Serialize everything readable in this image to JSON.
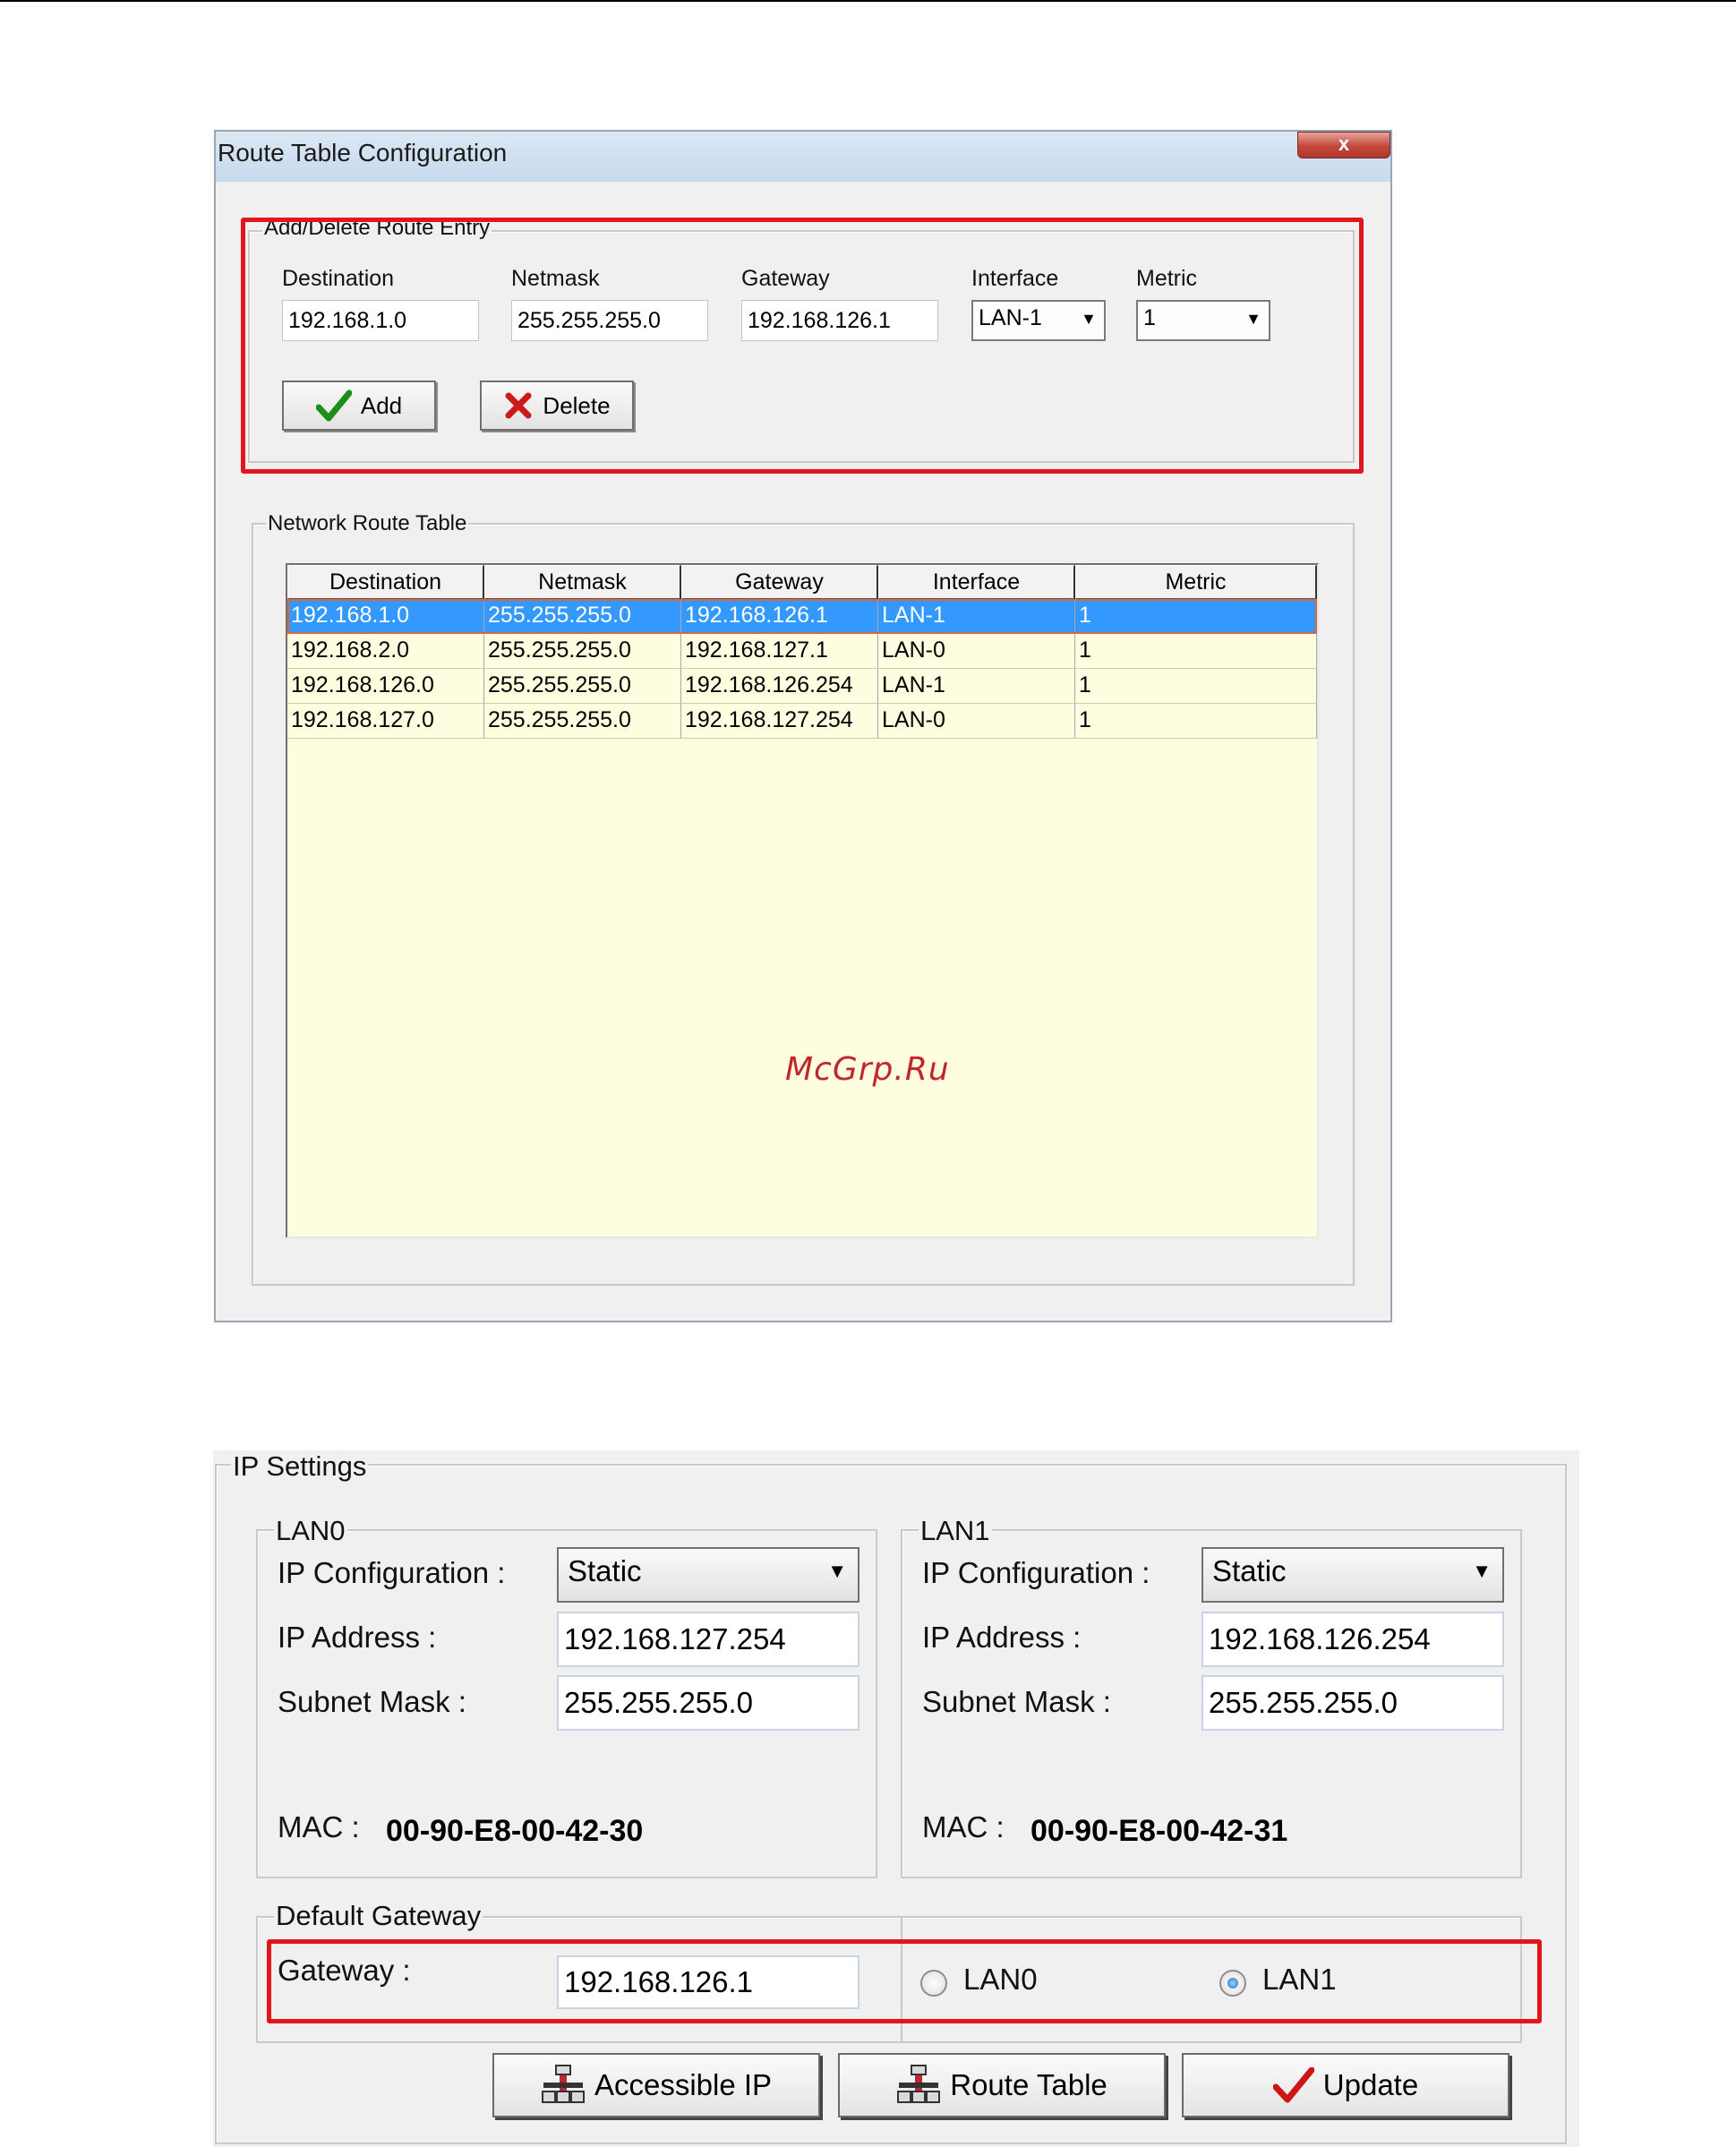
{
  "route_dialog": {
    "title": "Route Table Configuration",
    "close_label": "x",
    "entry_group": {
      "title": "Add/Delete Route Entry",
      "destination_label": "Destination",
      "destination_value": "192.168.1.0",
      "netmask_label": "Netmask",
      "netmask_value": "255.255.255.0",
      "gateway_label": "Gateway",
      "gateway_value": "192.168.126.1",
      "interface_label": "Interface",
      "interface_value": "LAN-1",
      "metric_label": "Metric",
      "metric_value": "1",
      "add_label": "Add",
      "delete_label": "Delete"
    },
    "table_group": {
      "title": "Network Route Table",
      "columns": [
        "Destination",
        "Netmask",
        "Gateway",
        "Interface",
        "Metric"
      ],
      "rows": [
        [
          "192.168.1.0",
          "255.255.255.0",
          "192.168.126.1",
          "LAN-1",
          "1"
        ],
        [
          "192.168.2.0",
          "255.255.255.0",
          "192.168.127.1",
          "LAN-0",
          "1"
        ],
        [
          "192.168.126.0",
          "255.255.255.0",
          "192.168.126.254",
          "LAN-1",
          "1"
        ],
        [
          "192.168.127.0",
          "255.255.255.0",
          "192.168.127.254",
          "LAN-0",
          "1"
        ]
      ],
      "selected_row": 0
    }
  },
  "watermark": "McGrp.Ru",
  "ip_settings": {
    "title": "IP Settings",
    "lan0": {
      "title": "LAN0",
      "ip_config_label": "IP Configuration :",
      "ip_config_value": "Static",
      "ip_address_label": "IP Address :",
      "ip_address_value": "192.168.127.254",
      "subnet_label": "Subnet Mask :",
      "subnet_value": "255.255.255.0",
      "mac_label": "MAC :",
      "mac_value": "00-90-E8-00-42-30"
    },
    "lan1": {
      "title": "LAN1",
      "ip_config_label": "IP Configuration :",
      "ip_config_value": "Static",
      "ip_address_label": "IP Address :",
      "ip_address_value": "192.168.126.254",
      "subnet_label": "Subnet Mask :",
      "subnet_value": "255.255.255.0",
      "mac_label": "MAC :",
      "mac_value": "00-90-E8-00-42-31"
    },
    "default_gateway": {
      "title": "Default Gateway",
      "gateway_label": "Gateway :",
      "gateway_value": "192.168.126.1",
      "radio_lan0": "LAN0",
      "radio_lan1": "LAN1",
      "selected": "LAN1"
    },
    "buttons": {
      "accessible_ip": "Accessible IP",
      "route_table": "Route Table",
      "update": "Update"
    }
  },
  "colors": {
    "highlight_red": "#e0161b",
    "selection_blue": "#3399ff",
    "table_background": "#fffde0"
  }
}
